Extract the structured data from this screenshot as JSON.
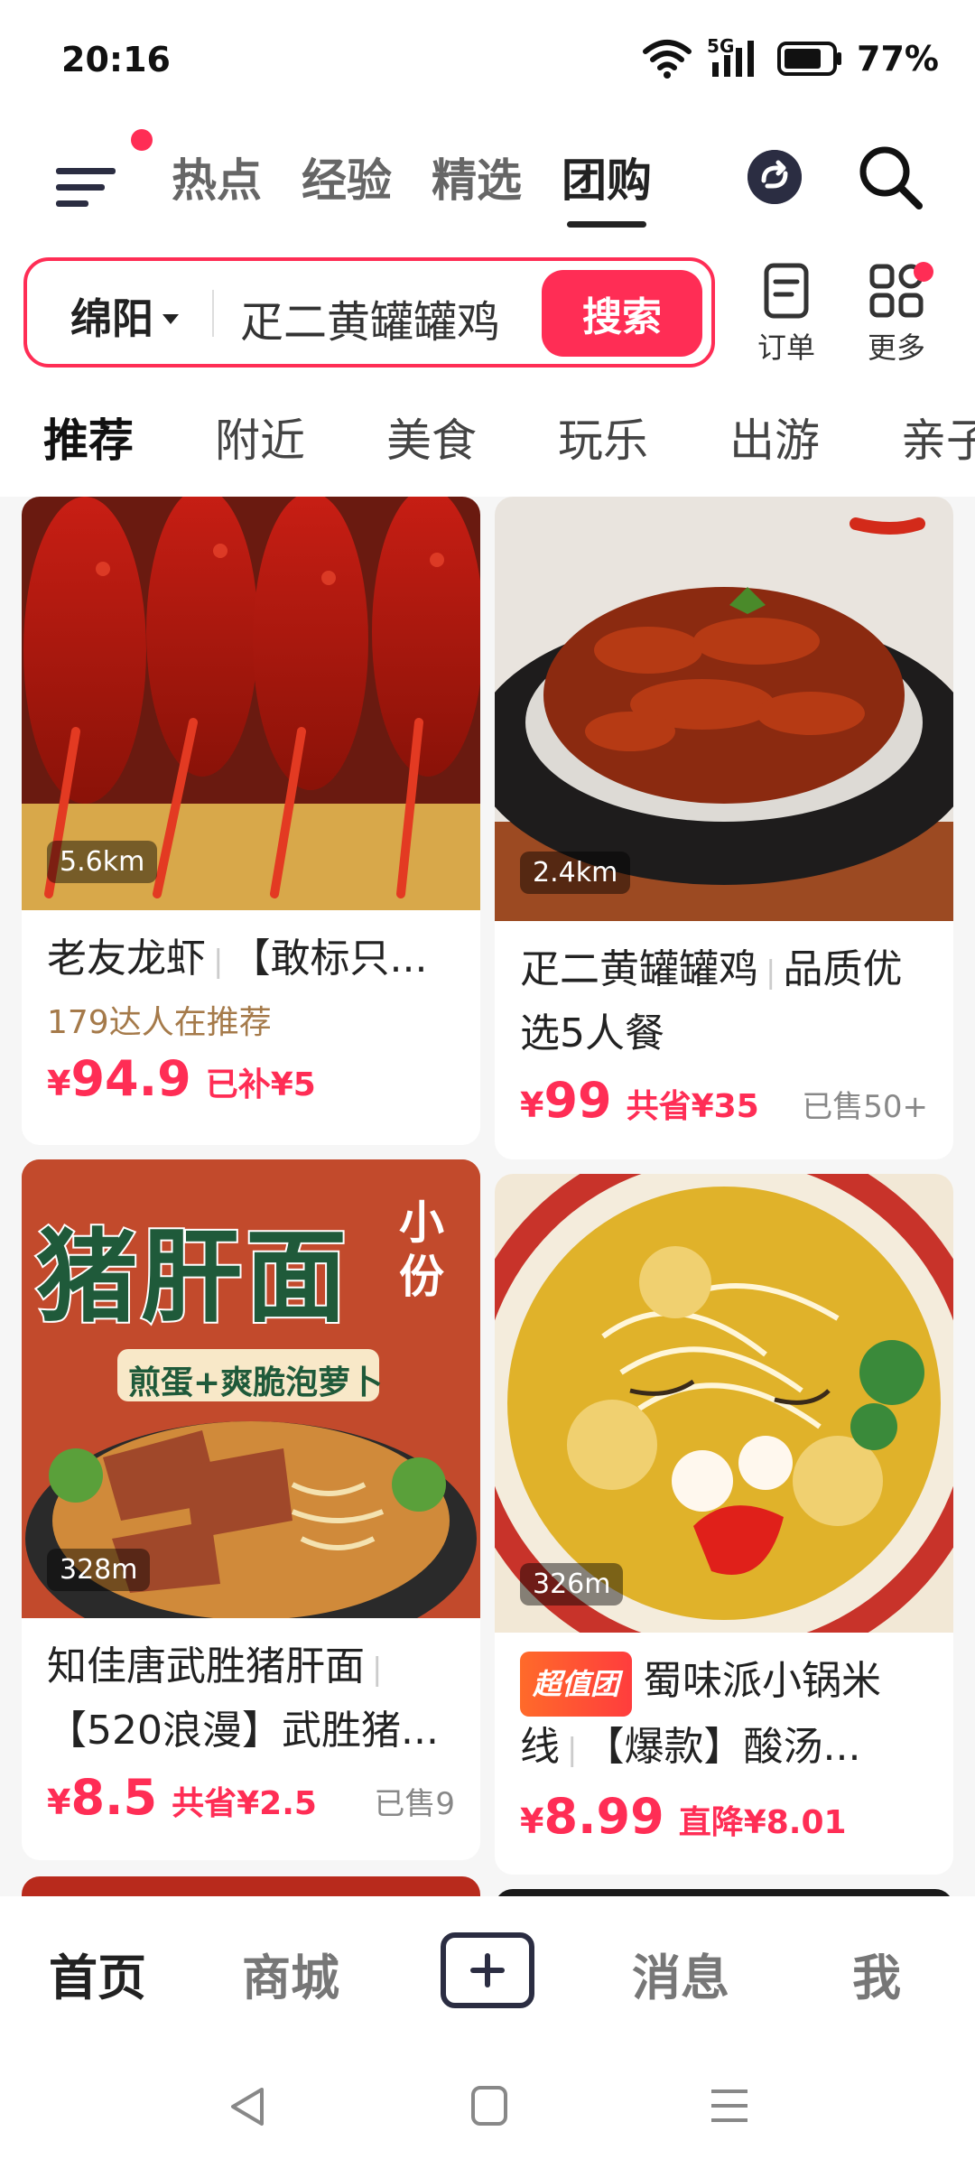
{
  "status_bar": {
    "time": "20:16",
    "network": "5G",
    "battery": "77%"
  },
  "top_tabs": [
    {
      "label": "热点",
      "active": false
    },
    {
      "label": "经验",
      "active": false
    },
    {
      "label": "精选",
      "active": false
    },
    {
      "label": "团购",
      "active": true
    }
  ],
  "search": {
    "city": "绵阳",
    "query": "疋二黄罐罐鸡",
    "button": "搜索"
  },
  "quick_actions": {
    "order": "订单",
    "more": "更多"
  },
  "categories": [
    "推荐",
    "附近",
    "美食",
    "玩乐",
    "出游",
    "亲子"
  ],
  "cards": [
    {
      "distance": "5.6km",
      "shop": "老友龙虾",
      "deal": "【敢标只...",
      "tagline": "179达人在推荐",
      "price": "94.9",
      "discount": "已补¥5",
      "sold": ""
    },
    {
      "distance": "2.4km",
      "shop": "疋二黄罐罐鸡",
      "deal": "品质优选5人餐",
      "price": "99",
      "discount": "共省¥35",
      "sold": "已售50+"
    },
    {
      "distance": "328m",
      "image_text": {
        "title": "猪肝面",
        "size": "小份",
        "sub": "煎蛋+爽脆泡萝卜"
      },
      "shop": "知佳唐武胜猪肝面",
      "deal": "【520浪漫】武胜猪...",
      "price": "8.5",
      "discount": "共省¥2.5",
      "sold": "已售9"
    },
    {
      "distance": "326m",
      "badge": "超值团",
      "shop": "蜀味派小锅米线",
      "deal": "【爆款】酸汤...",
      "price": "8.99",
      "discount": "直降¥8.01",
      "sold": ""
    }
  ],
  "bottom_nav": {
    "home": "首页",
    "mall": "商城",
    "messages": "消息",
    "me": "我"
  },
  "currency_symbol": "¥",
  "colors": {
    "accent": "#ff2d55",
    "tagline": "#a57a4a"
  }
}
